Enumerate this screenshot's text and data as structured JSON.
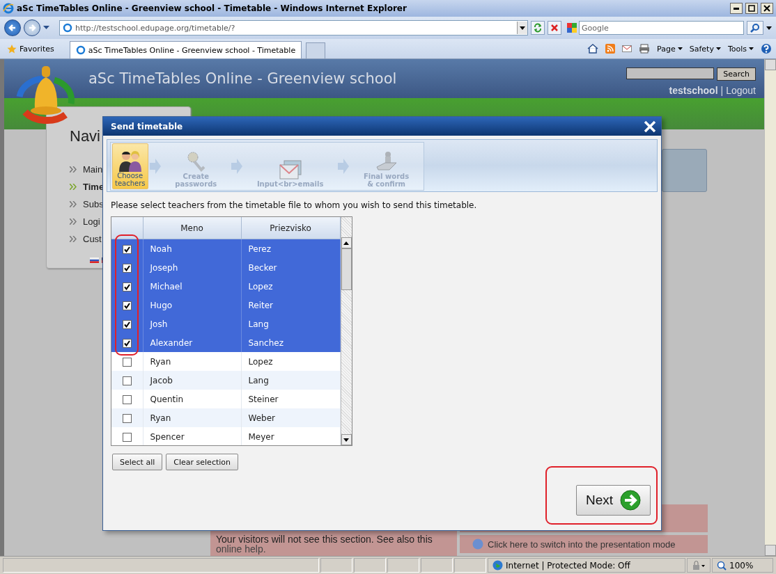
{
  "window": {
    "title": "aSc TimeTables Online - Greenview school - Timetable - Windows Internet Explorer"
  },
  "address_bar": {
    "url": "http://testschool.edupage.org/timetable/?",
    "search_placeholder": "Google"
  },
  "favorites": {
    "label": "Favorites"
  },
  "tabs": [
    {
      "label": "aSc TimeTables Online - Greenview school - Timetable",
      "selected": true
    }
  ],
  "command_bar": [
    "Page",
    "Safety",
    "Tools"
  ],
  "site": {
    "title": "aSc TimeTables Online - Greenview school",
    "search_button": "Search",
    "user": "testschool",
    "separator": "|",
    "logout": "Logout",
    "nav_heading": "Navi",
    "nav_items": [
      {
        "label": "Main",
        "selected": false
      },
      {
        "label": "Time",
        "selected": true
      },
      {
        "label": "Subs",
        "selected": false
      },
      {
        "label": "Logi",
        "selected": false
      },
      {
        "label": "Cust",
        "selected": false
      }
    ],
    "admin_note": "Your visitors will not see this section. See also this",
    "help_link": "online help.",
    "presentation_link": "Click here to switch into the presentation mode"
  },
  "dialog": {
    "title": "Send timetable",
    "steps": [
      {
        "kind": "teachers",
        "label": "Choose\nteachers",
        "selected": true
      },
      {
        "kind": "passwords",
        "label": "Create\npasswords",
        "selected": false
      },
      {
        "kind": "emails",
        "label": "Input<br>emails",
        "selected": false
      },
      {
        "kind": "confirm",
        "label": "Final words\n& confirm",
        "selected": false
      }
    ],
    "instruction": "Please select teachers from the timetable file to whom you wish to send this timetable.",
    "table": {
      "columns": [
        "Meno",
        "Priezvisko"
      ],
      "rows": [
        {
          "first": "Noah",
          "last": "Perez",
          "checked": true,
          "selected": true
        },
        {
          "first": "Joseph",
          "last": "Becker",
          "checked": true,
          "selected": true
        },
        {
          "first": "Michael",
          "last": "Lopez",
          "checked": true,
          "selected": true
        },
        {
          "first": "Hugo",
          "last": "Reiter",
          "checked": true,
          "selected": true
        },
        {
          "first": "Josh",
          "last": "Lang",
          "checked": true,
          "selected": true
        },
        {
          "first": "Alexander",
          "last": "Sanchez",
          "checked": true,
          "selected": true
        },
        {
          "first": "Ryan",
          "last": "Lopez",
          "checked": false,
          "selected": false
        },
        {
          "first": "Jacob",
          "last": "Lang",
          "checked": false,
          "selected": false
        },
        {
          "first": "Quentin",
          "last": "Steiner",
          "checked": false,
          "selected": false
        },
        {
          "first": "Ryan",
          "last": "Weber",
          "checked": false,
          "selected": false
        },
        {
          "first": "Spencer",
          "last": "Meyer",
          "checked": false,
          "selected": false
        }
      ]
    },
    "buttons": [
      "Select all",
      "Clear selection"
    ],
    "next_button": "Next"
  },
  "status_bar": {
    "zone": "Internet | Protected Mode: Off",
    "zoom": "100%"
  }
}
